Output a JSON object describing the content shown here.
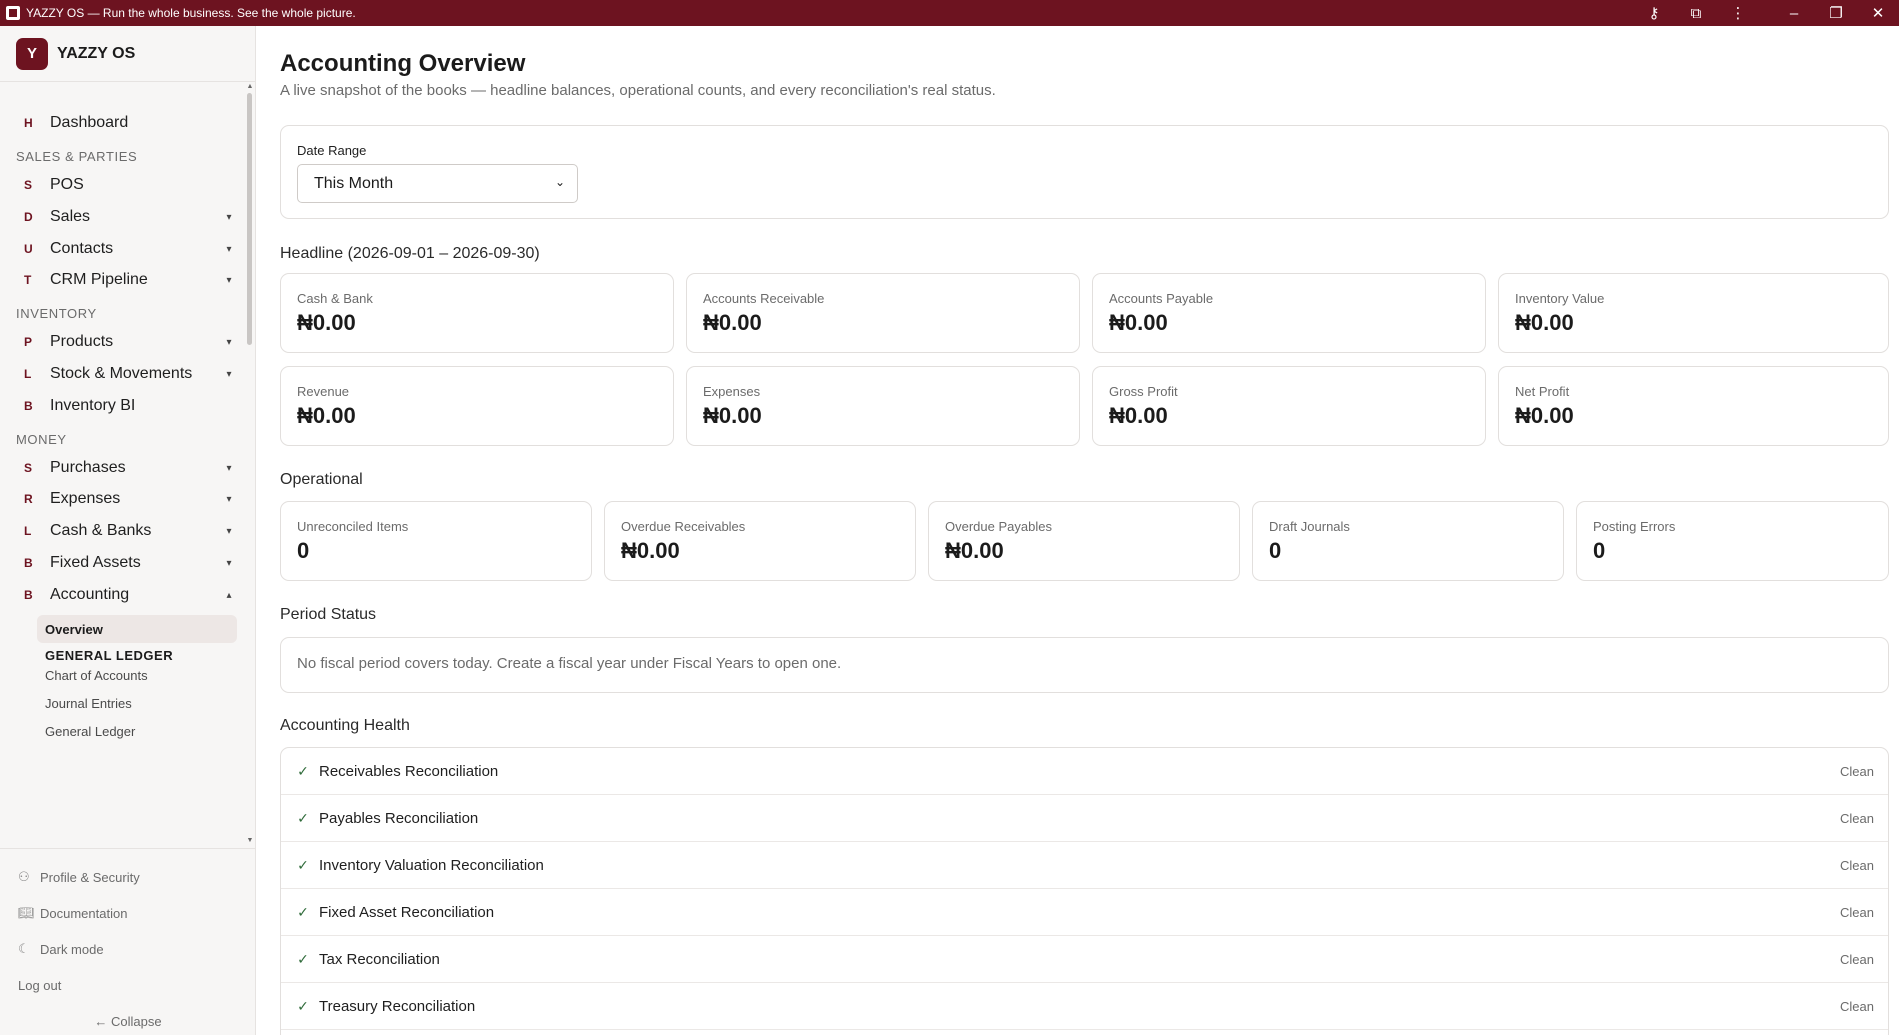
{
  "window": {
    "title": "YAZZY OS — Run the whole business. See the whole picture."
  },
  "brand": {
    "logo_letter": "Y",
    "name": "YAZZY OS"
  },
  "sidebar": {
    "top_items": [
      {
        "letter": "H",
        "label": "Dashboard"
      }
    ],
    "sections": [
      {
        "title": "SALES & PARTIES"
      },
      {
        "title": "INVENTORY"
      },
      {
        "title": "MONEY"
      }
    ],
    "items": [
      {
        "letter": "S",
        "label": "POS"
      },
      {
        "letter": "D",
        "label": "Sales",
        "caret": "▾"
      },
      {
        "letter": "U",
        "label": "Contacts",
        "caret": "▾"
      },
      {
        "letter": "T",
        "label": "CRM Pipeline",
        "caret": "▾"
      },
      {
        "letter": "P",
        "label": "Products",
        "caret": "▾"
      },
      {
        "letter": "L",
        "label": "Stock & Movements",
        "caret": "▾"
      },
      {
        "letter": "B",
        "label": "Inventory BI"
      },
      {
        "letter": "S",
        "label": "Purchases",
        "caret": "▾"
      },
      {
        "letter": "R",
        "label": "Expenses",
        "caret": "▾"
      },
      {
        "letter": "L",
        "label": "Cash & Banks",
        "caret": "▾"
      },
      {
        "letter": "B",
        "label": "Fixed Assets",
        "caret": "▾"
      },
      {
        "letter": "B",
        "label": "Accounting",
        "caret": "▴"
      }
    ],
    "subnav": {
      "active": "Overview",
      "group_header": "GENERAL LEDGER",
      "items": [
        "Chart of Accounts",
        "Journal Entries",
        "General Ledger"
      ]
    },
    "footer": {
      "profile": "Profile & Security",
      "docs": "Documentation",
      "dark_mode": "Dark mode",
      "logout": "Log out",
      "collapse": "← Collapse"
    }
  },
  "page": {
    "title": "Accounting Overview",
    "subtitle": "A live snapshot of the books — headline balances, operational counts, and every reconciliation's real status."
  },
  "filter": {
    "label": "Date Range",
    "selected": "This Month"
  },
  "headline": {
    "title": "Headline (2026-09-01 – 2026-09-30)",
    "cards": [
      {
        "label": "Cash & Bank",
        "value": "₦0.00"
      },
      {
        "label": "Accounts Receivable",
        "value": "₦0.00"
      },
      {
        "label": "Accounts Payable",
        "value": "₦0.00"
      },
      {
        "label": "Inventory Value",
        "value": "₦0.00"
      },
      {
        "label": "Revenue",
        "value": "₦0.00"
      },
      {
        "label": "Expenses",
        "value": "₦0.00"
      },
      {
        "label": "Gross Profit",
        "value": "₦0.00"
      },
      {
        "label": "Net Profit",
        "value": "₦0.00"
      }
    ]
  },
  "operational": {
    "title": "Operational",
    "cards": [
      {
        "label": "Unreconciled Items",
        "value": "0"
      },
      {
        "label": "Overdue Receivables",
        "value": "₦0.00"
      },
      {
        "label": "Overdue Payables",
        "value": "₦0.00"
      },
      {
        "label": "Draft Journals",
        "value": "0"
      },
      {
        "label": "Posting Errors",
        "value": "0"
      }
    ]
  },
  "period": {
    "title": "Period Status",
    "message": "No fiscal period covers today. Create a fiscal year under Fiscal Years to open one."
  },
  "health": {
    "title": "Accounting Health",
    "rows": [
      {
        "label": "Receivables Reconciliation",
        "status": "Clean"
      },
      {
        "label": "Payables Reconciliation",
        "status": "Clean"
      },
      {
        "label": "Inventory Valuation Reconciliation",
        "status": "Clean"
      },
      {
        "label": "Fixed Asset Reconciliation",
        "status": "Clean"
      },
      {
        "label": "Tax Reconciliation",
        "status": "Clean"
      },
      {
        "label": "Treasury Reconciliation",
        "status": "Clean"
      }
    ]
  },
  "icons": {
    "titlebar": [
      "key-icon",
      "extensions-icon",
      "more-icon",
      "minimize-icon",
      "restore-icon",
      "close-icon"
    ],
    "check": "check-icon"
  },
  "colors": {
    "brand": "#6d1320",
    "check": "#2f6b3a"
  }
}
